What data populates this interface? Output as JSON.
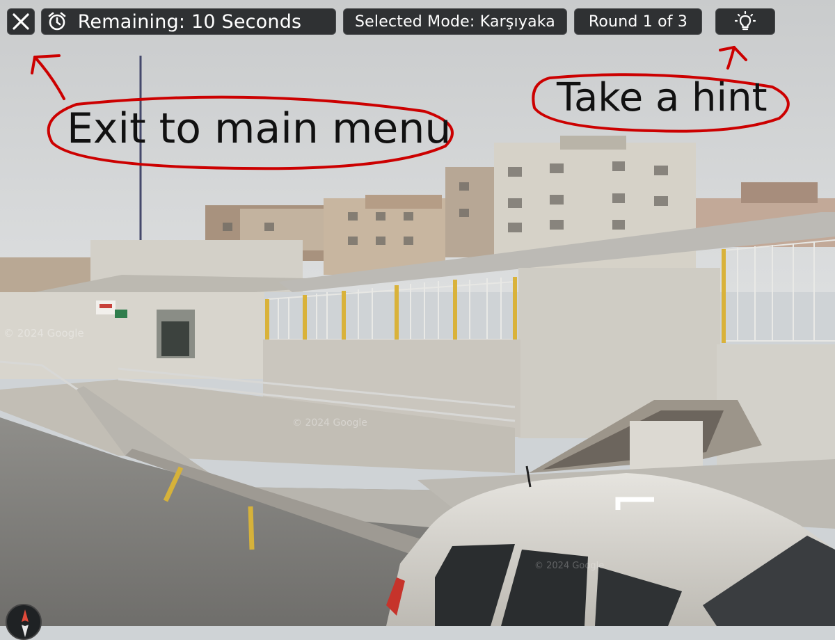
{
  "toolbar": {
    "close_icon": "close-icon",
    "timer_icon": "alarm-clock-icon",
    "timer_text": "Remaining: 10 Seconds",
    "mode_text": "Selected Mode: Karşıyaka",
    "round_text": "Round 1 of 3",
    "hint_icon": "lightbulb-icon"
  },
  "annotations": {
    "exit_label": "Exit to main menu",
    "hint_label": "Take a hint",
    "color": "#cc0000"
  },
  "scene": {
    "watermark_1": "© 2024 Google",
    "watermark_2": "© 2024 Google",
    "watermark_3": "© 2024 Google"
  },
  "compass_icon": "compass-icon"
}
